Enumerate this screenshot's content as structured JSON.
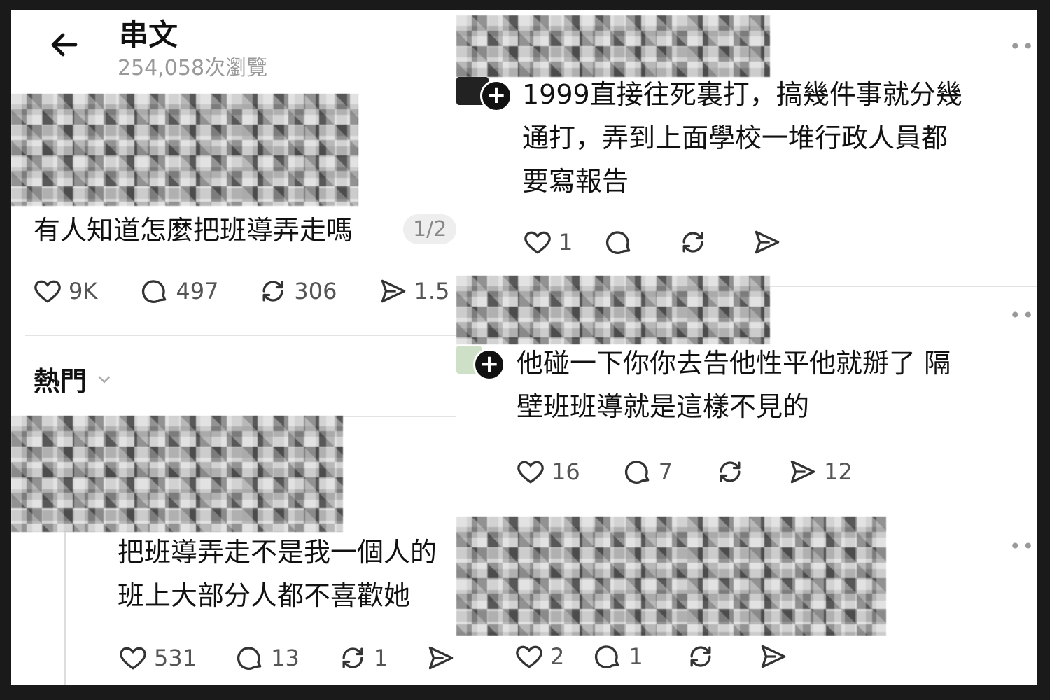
{
  "header": {
    "title": "串文",
    "views": "254,058次瀏覽"
  },
  "main_post": {
    "text": "有人知道怎麼把班導弄走嗎",
    "page_badge": "1/2",
    "likes": "9K",
    "comments": "497",
    "reposts": "306",
    "shares": "1.5"
  },
  "sort": {
    "label": "熱門"
  },
  "replies": [
    {
      "line1": "把班導弄走不是我一個人的",
      "line2": "班上大部分人都不喜歡她",
      "likes": "531",
      "comments": "13",
      "reposts": "1"
    },
    {
      "line1": "1999直接往死裏打，搞幾件事就分幾",
      "line2": "通打，弄到上面學校一堆行政人員都",
      "line3": "要寫報告",
      "likes": "1"
    },
    {
      "line1": "他碰一下你你去告他性平他就掰了 隔",
      "line2": "壁班班導就是這樣不見的",
      "likes": "16",
      "comments": "7",
      "shares": "12"
    },
    {
      "likes": "2",
      "comments": "1"
    }
  ],
  "icons": {
    "back": "arrow-left-icon",
    "like": "heart-icon",
    "comment": "comment-icon",
    "repost": "repost-icon",
    "share": "share-icon",
    "more": "more-icon",
    "follow": "plus-icon",
    "sort": "chevron-down-icon"
  }
}
